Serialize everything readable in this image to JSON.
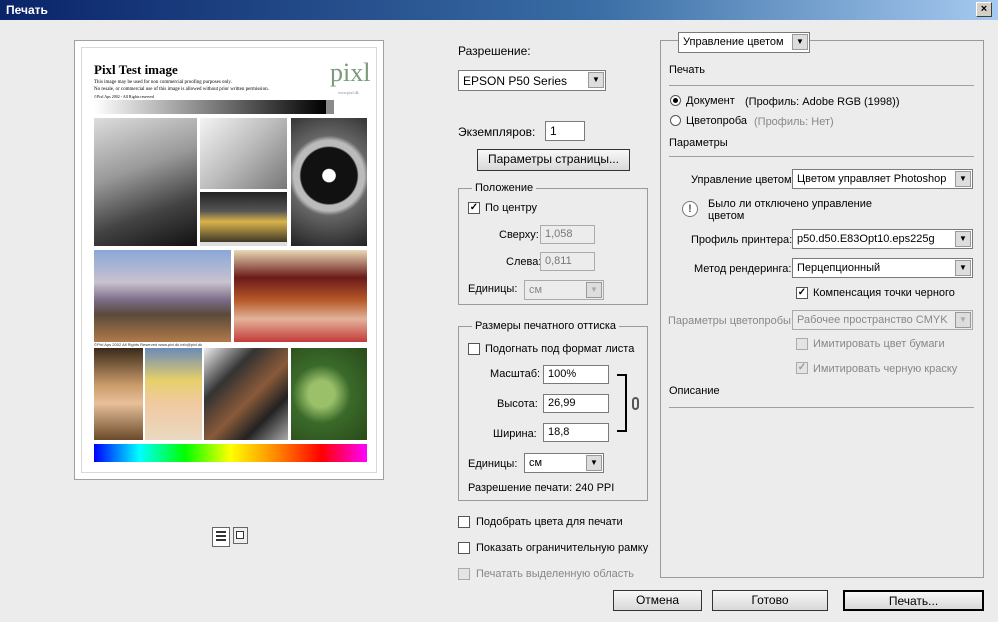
{
  "window": {
    "title": "Печать",
    "close": "×"
  },
  "preview": {
    "heading": "Pixl Test image",
    "line1": "This image may be used for non commercial proofing purposes only.",
    "line2": "No resale, or commercial use of this image is allowed without prior written permission.",
    "line3": "©Pixl Aps 2002 - All Rights reserved",
    "logo": "pixl",
    "logo_sub": "www.pixl.dk",
    "footer": "©Pixl Aps 2002   All Rights Reserved   www.pixl.dk   info@pixl.dk"
  },
  "resolution": {
    "label": "Разрешение:",
    "printer": "EPSON P50 Series"
  },
  "copies": {
    "label": "Экземпляров:",
    "value": "1"
  },
  "page_setup_button": "Параметры страницы...",
  "position": {
    "legend": "Положение",
    "center_label": "По центру",
    "center_checked": true,
    "top_label": "Сверху:",
    "top_value": "1,058",
    "left_label": "Слева:",
    "left_value": "0,811",
    "units_label": "Единицы:",
    "units_value": "см"
  },
  "scaled": {
    "legend": "Размеры печатного оттиска",
    "fit_label": "Подогнать под формат листа",
    "scale_label": "Масштаб:",
    "scale_value": "100%",
    "height_label": "Высота:",
    "height_value": "26,99",
    "width_label": "Ширина:",
    "width_value": "18,8",
    "units_label": "Единицы:",
    "units_value": "см",
    "print_res": "Разрешение печати: 240 PPI"
  },
  "bottom_checks": {
    "match_colors": "Подобрать цвета для печати",
    "bounding_box": "Показать ограничительную рамку",
    "selected_area": "Печатать выделенную область"
  },
  "right": {
    "mode_dropdown": "Управление цветом",
    "print_section": "Печать",
    "document_label": "Документ",
    "document_profile": "(Профиль: Adobe RGB (1998))",
    "proof_label": "Цветопроба",
    "proof_profile": "(Профиль: Нет)",
    "options_section": "Параметры",
    "color_handling_label": "Управление цветом:",
    "color_handling_value": "Цветом управляет Photoshop",
    "warning_text": "Было ли отключено управление цветом",
    "printer_profile_label": "Профиль принтера:",
    "printer_profile_value": "p50.d50.E83Opt10.eps225g",
    "rendering_label": "Метод рендеринга:",
    "rendering_value": "Перцепционный",
    "bpc_label": "Компенсация точки черного",
    "bpc_checked": true,
    "proof_setup_label": "Параметры цветопробы:",
    "proof_setup_value": "Рабочее пространство CMYK",
    "simulate_paper": "Имитировать цвет бумаги",
    "simulate_ink": "Имитировать черную краску",
    "description_section": "Описание"
  },
  "buttons": {
    "cancel": "Отмена",
    "done": "Готово",
    "print": "Печать..."
  }
}
